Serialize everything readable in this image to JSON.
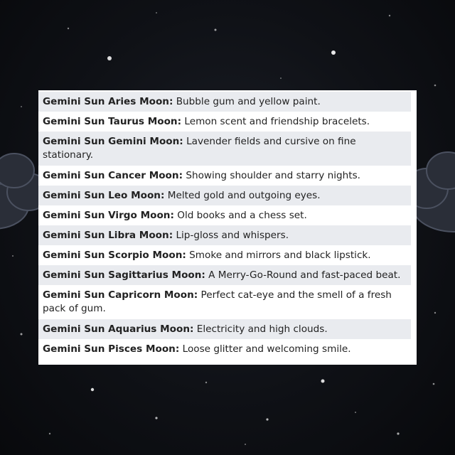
{
  "pairings": [
    {
      "sign": "Gemini Sun Aries Moon:",
      "text": " Bubble gum and yellow paint."
    },
    {
      "sign": "Gemini Sun Taurus Moon:",
      "text": " Lemon scent and friendship bracelets."
    },
    {
      "sign": "Gemini Sun Gemini Moon:",
      "text": " Lavender fields and cursive on fine stationary."
    },
    {
      "sign": "Gemini Sun Cancer Moon:",
      "text": " Showing shoulder and starry nights."
    },
    {
      "sign": "Gemini Sun Leo Moon:",
      "text": " Melted gold and outgoing eyes."
    },
    {
      "sign": "Gemini Sun Virgo Moon:",
      "text": " Old books and a chess set."
    },
    {
      "sign": "Gemini Sun Libra Moon:",
      "text": " Lip-gloss and whispers."
    },
    {
      "sign": "Gemini Sun Scorpio Moon:",
      "text": " Smoke and mirrors and black lipstick."
    },
    {
      "sign": "Gemini Sun Sagittarius Moon:",
      "text": " A Merry-Go-Round and fast-paced beat."
    },
    {
      "sign": "Gemini Sun Capricorn Moon:",
      "text": " Perfect cat-eye and the smell of a fresh pack of gum."
    },
    {
      "sign": "Gemini Sun Aquarius Moon:",
      "text": " Electricity and high clouds."
    },
    {
      "sign": "Gemini Sun Pisces Moon:",
      "text": " Loose glitter and welcoming smile."
    }
  ]
}
